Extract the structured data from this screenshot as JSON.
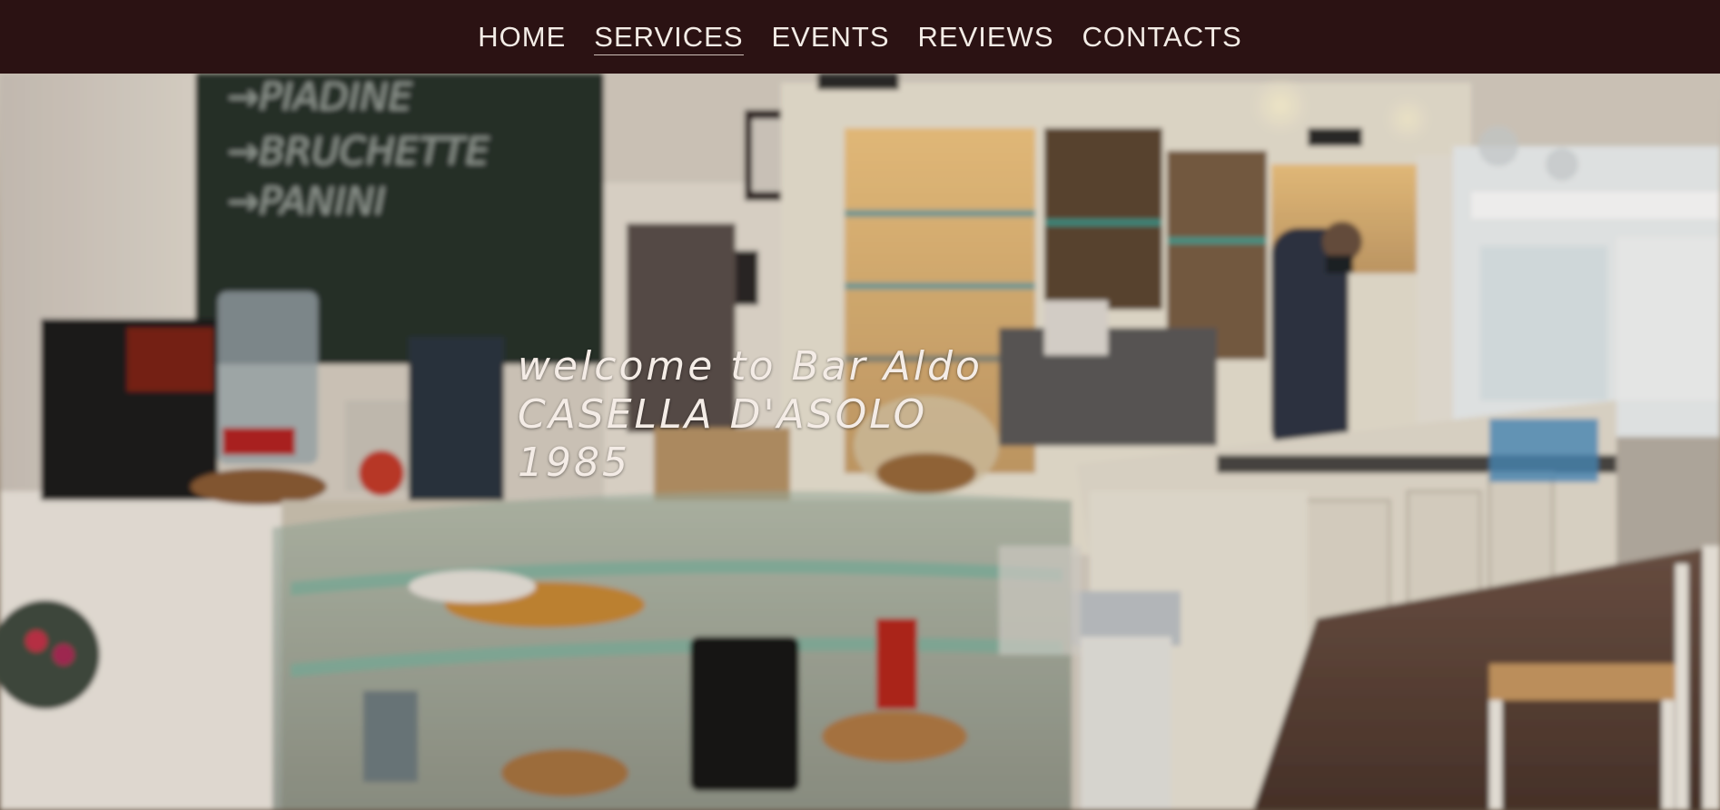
{
  "nav": {
    "items": [
      {
        "label": "HOME",
        "active": false
      },
      {
        "label": "SERVICES",
        "active": true
      },
      {
        "label": "EVENTS",
        "active": false
      },
      {
        "label": "REVIEWS",
        "active": false
      },
      {
        "label": "CONTACTS",
        "active": false
      }
    ]
  },
  "hero": {
    "line1": "welcome to Bar Aldo",
    "line2": "CASELLA D'ASOLO",
    "line3": "1985",
    "background": "blurred photo of bar interior with glass display counter and shelves"
  },
  "colors": {
    "navbar_bg": "#2b1213",
    "nav_text": "#f3ece6",
    "hero_text": "#f4ece6"
  }
}
